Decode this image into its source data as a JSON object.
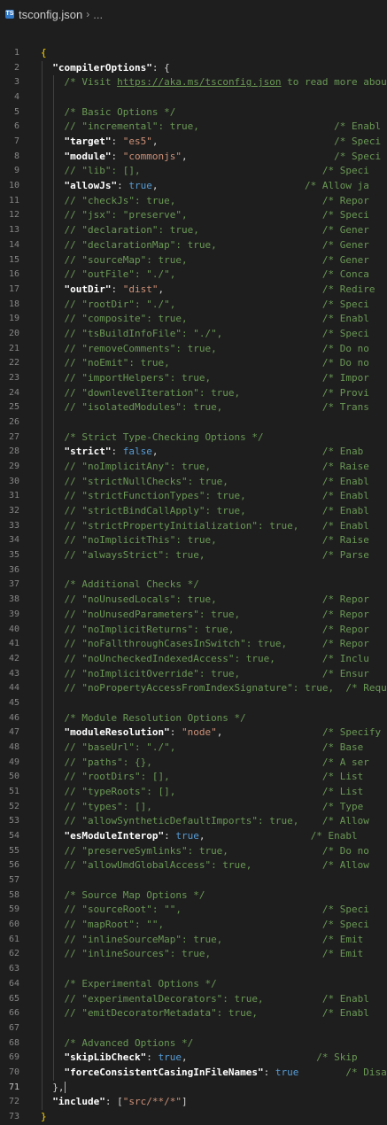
{
  "breadcrumb": {
    "icon": "typescript-file-icon",
    "file": "tsconfig.json",
    "separator": "›",
    "more": "..."
  },
  "colors": {
    "background": "#1e1e1e",
    "comment": "#6a9955",
    "string": "#ce9178",
    "keyword": "#569cd6",
    "key": "#9cdcfe"
  },
  "lines": [
    {
      "n": "1",
      "segs": [
        [
          "brk",
          "{"
        ]
      ]
    },
    {
      "n": "2",
      "segs": [
        [
          "pn",
          "  "
        ],
        [
          "keyb",
          "\"compilerOptions\""
        ],
        [
          "pn",
          ": {"
        ]
      ]
    },
    {
      "n": "3",
      "segs": [
        [
          "pn",
          "    "
        ],
        [
          "cm",
          "/* Visit "
        ],
        [
          "cm-link",
          "https://aka.ms/tsconfig.json"
        ],
        [
          "cm",
          " to read more about"
        ]
      ]
    },
    {
      "n": "4",
      "segs": []
    },
    {
      "n": "5",
      "segs": [
        [
          "pn",
          "    "
        ],
        [
          "cm",
          "/* Basic Options */"
        ]
      ]
    },
    {
      "n": "6",
      "segs": [
        [
          "pn",
          "    "
        ],
        [
          "cm",
          "// \"incremental\": true,                       /* Enabl"
        ]
      ]
    },
    {
      "n": "7",
      "segs": [
        [
          "pn",
          "    "
        ],
        [
          "keyb",
          "\"target\""
        ],
        [
          "pn",
          ": "
        ],
        [
          "str",
          "\"es5\""
        ],
        [
          "pn",
          ",                              "
        ],
        [
          "cm",
          "/* Speci"
        ]
      ]
    },
    {
      "n": "8",
      "segs": [
        [
          "pn",
          "    "
        ],
        [
          "keyb",
          "\"module\""
        ],
        [
          "pn",
          ": "
        ],
        [
          "str",
          "\"commonjs\""
        ],
        [
          "pn",
          ",                         "
        ],
        [
          "cm",
          "/* Speci"
        ]
      ]
    },
    {
      "n": "9",
      "segs": [
        [
          "pn",
          "    "
        ],
        [
          "cm",
          "// \"lib\": [],                               /* Speci"
        ]
      ]
    },
    {
      "n": "10",
      "segs": [
        [
          "pn",
          "    "
        ],
        [
          "keyb",
          "\"allowJs\""
        ],
        [
          "pn",
          ": "
        ],
        [
          "kw",
          "true"
        ],
        [
          "pn",
          ",                         "
        ],
        [
          "cm",
          "/* Allow ja"
        ]
      ]
    },
    {
      "n": "11",
      "segs": [
        [
          "pn",
          "    "
        ],
        [
          "cm",
          "// \"checkJs\": true,                         /* Repor"
        ]
      ]
    },
    {
      "n": "12",
      "segs": [
        [
          "pn",
          "    "
        ],
        [
          "cm",
          "// \"jsx\": \"preserve\",                       /* Speci"
        ]
      ]
    },
    {
      "n": "13",
      "segs": [
        [
          "pn",
          "    "
        ],
        [
          "cm",
          "// \"declaration\": true,                     /* Gener"
        ]
      ]
    },
    {
      "n": "14",
      "segs": [
        [
          "pn",
          "    "
        ],
        [
          "cm",
          "// \"declarationMap\": true,                  /* Gener"
        ]
      ]
    },
    {
      "n": "15",
      "segs": [
        [
          "pn",
          "    "
        ],
        [
          "cm",
          "// \"sourceMap\": true,                       /* Gener"
        ]
      ]
    },
    {
      "n": "16",
      "segs": [
        [
          "pn",
          "    "
        ],
        [
          "cm",
          "// \"outFile\": \"./\",                         /* Conca"
        ]
      ]
    },
    {
      "n": "17",
      "segs": [
        [
          "pn",
          "    "
        ],
        [
          "keyb",
          "\"outDir\""
        ],
        [
          "pn",
          ": "
        ],
        [
          "str",
          "\"dist\""
        ],
        [
          "pn",
          ",                           "
        ],
        [
          "cm",
          "/* Redire"
        ]
      ]
    },
    {
      "n": "18",
      "segs": [
        [
          "pn",
          "    "
        ],
        [
          "cm",
          "// \"rootDir\": \"./\",                         /* Speci"
        ]
      ]
    },
    {
      "n": "19",
      "segs": [
        [
          "pn",
          "    "
        ],
        [
          "cm",
          "// \"composite\": true,                       /* Enabl"
        ]
      ]
    },
    {
      "n": "20",
      "segs": [
        [
          "pn",
          "    "
        ],
        [
          "cm",
          "// \"tsBuildInfoFile\": \"./\",                 /* Speci"
        ]
      ]
    },
    {
      "n": "21",
      "segs": [
        [
          "pn",
          "    "
        ],
        [
          "cm",
          "// \"removeComments\": true,                  /* Do no"
        ]
      ]
    },
    {
      "n": "22",
      "segs": [
        [
          "pn",
          "    "
        ],
        [
          "cm",
          "// \"noEmit\": true,                          /* Do no"
        ]
      ]
    },
    {
      "n": "23",
      "segs": [
        [
          "pn",
          "    "
        ],
        [
          "cm",
          "// \"importHelpers\": true,                   /* Impor"
        ]
      ]
    },
    {
      "n": "24",
      "segs": [
        [
          "pn",
          "    "
        ],
        [
          "cm",
          "// \"downlevelIteration\": true,              /* Provi"
        ]
      ]
    },
    {
      "n": "25",
      "segs": [
        [
          "pn",
          "    "
        ],
        [
          "cm",
          "// \"isolatedModules\": true,                 /* Trans"
        ]
      ]
    },
    {
      "n": "26",
      "segs": []
    },
    {
      "n": "27",
      "segs": [
        [
          "pn",
          "    "
        ],
        [
          "cm",
          "/* Strict Type-Checking Options */"
        ]
      ]
    },
    {
      "n": "28",
      "segs": [
        [
          "pn",
          "    "
        ],
        [
          "keyb",
          "\"strict\""
        ],
        [
          "pn",
          ": "
        ],
        [
          "kw",
          "false"
        ],
        [
          "pn",
          ",                            "
        ],
        [
          "cm",
          "/* Enab"
        ]
      ]
    },
    {
      "n": "29",
      "segs": [
        [
          "pn",
          "    "
        ],
        [
          "cm",
          "// \"noImplicitAny\": true,                   /* Raise"
        ]
      ]
    },
    {
      "n": "30",
      "segs": [
        [
          "pn",
          "    "
        ],
        [
          "cm",
          "// \"strictNullChecks\": true,                /* Enabl"
        ]
      ]
    },
    {
      "n": "31",
      "segs": [
        [
          "pn",
          "    "
        ],
        [
          "cm",
          "// \"strictFunctionTypes\": true,             /* Enabl"
        ]
      ]
    },
    {
      "n": "32",
      "segs": [
        [
          "pn",
          "    "
        ],
        [
          "cm",
          "// \"strictBindCallApply\": true,             /* Enabl"
        ]
      ]
    },
    {
      "n": "33",
      "segs": [
        [
          "pn",
          "    "
        ],
        [
          "cm",
          "// \"strictPropertyInitialization\": true,    /* Enabl"
        ]
      ]
    },
    {
      "n": "34",
      "segs": [
        [
          "pn",
          "    "
        ],
        [
          "cm",
          "// \"noImplicitThis\": true,                  /* Raise"
        ]
      ]
    },
    {
      "n": "35",
      "segs": [
        [
          "pn",
          "    "
        ],
        [
          "cm",
          "// \"alwaysStrict\": true,                    /* Parse"
        ]
      ]
    },
    {
      "n": "36",
      "segs": []
    },
    {
      "n": "37",
      "segs": [
        [
          "pn",
          "    "
        ],
        [
          "cm",
          "/* Additional Checks */"
        ]
      ]
    },
    {
      "n": "38",
      "segs": [
        [
          "pn",
          "    "
        ],
        [
          "cm",
          "// \"noUnusedLocals\": true,                  /* Repor"
        ]
      ]
    },
    {
      "n": "39",
      "segs": [
        [
          "pn",
          "    "
        ],
        [
          "cm",
          "// \"noUnusedParameters\": true,              /* Repor"
        ]
      ]
    },
    {
      "n": "40",
      "segs": [
        [
          "pn",
          "    "
        ],
        [
          "cm",
          "// \"noImplicitReturns\": true,               /* Repor"
        ]
      ]
    },
    {
      "n": "41",
      "segs": [
        [
          "pn",
          "    "
        ],
        [
          "cm",
          "// \"noFallthroughCasesInSwitch\": true,      /* Repor"
        ]
      ]
    },
    {
      "n": "42",
      "segs": [
        [
          "pn",
          "    "
        ],
        [
          "cm",
          "// \"noUncheckedIndexedAccess\": true,        /* Inclu"
        ]
      ]
    },
    {
      "n": "43",
      "segs": [
        [
          "pn",
          "    "
        ],
        [
          "cm",
          "// \"noImplicitOverride\": true,              /* Ensur"
        ]
      ]
    },
    {
      "n": "44",
      "segs": [
        [
          "pn",
          "    "
        ],
        [
          "cm",
          "// \"noPropertyAccessFromIndexSignature\": true,  /* Requi"
        ]
      ]
    },
    {
      "n": "45",
      "segs": []
    },
    {
      "n": "46",
      "segs": [
        [
          "pn",
          "    "
        ],
        [
          "cm",
          "/* Module Resolution Options */"
        ]
      ]
    },
    {
      "n": "47",
      "segs": [
        [
          "pn",
          "    "
        ],
        [
          "keyb",
          "\"moduleResolution\""
        ],
        [
          "pn",
          ": "
        ],
        [
          "str",
          "\"node\""
        ],
        [
          "pn",
          ",                 "
        ],
        [
          "cm",
          "/* Specify"
        ]
      ]
    },
    {
      "n": "48",
      "segs": [
        [
          "pn",
          "    "
        ],
        [
          "cm",
          "// \"baseUrl\": \"./\",                         /* Base"
        ]
      ]
    },
    {
      "n": "49",
      "segs": [
        [
          "pn",
          "    "
        ],
        [
          "cm",
          "// \"paths\": {},                             /* A ser"
        ]
      ]
    },
    {
      "n": "50",
      "segs": [
        [
          "pn",
          "    "
        ],
        [
          "cm",
          "// \"rootDirs\": [],                          /* List"
        ]
      ]
    },
    {
      "n": "51",
      "segs": [
        [
          "pn",
          "    "
        ],
        [
          "cm",
          "// \"typeRoots\": [],                         /* List"
        ]
      ]
    },
    {
      "n": "52",
      "segs": [
        [
          "pn",
          "    "
        ],
        [
          "cm",
          "// \"types\": [],                             /* Type"
        ]
      ]
    },
    {
      "n": "53",
      "segs": [
        [
          "pn",
          "    "
        ],
        [
          "cm",
          "// \"allowSyntheticDefaultImports\": true,    /* Allow"
        ]
      ]
    },
    {
      "n": "54",
      "segs": [
        [
          "pn",
          "    "
        ],
        [
          "keyb",
          "\"esModuleInterop\""
        ],
        [
          "pn",
          ": "
        ],
        [
          "kw",
          "true"
        ],
        [
          "pn",
          ",                  "
        ],
        [
          "cm",
          "/* Enabl"
        ]
      ]
    },
    {
      "n": "55",
      "segs": [
        [
          "pn",
          "    "
        ],
        [
          "cm",
          "// \"preserveSymlinks\": true,                /* Do no"
        ]
      ]
    },
    {
      "n": "56",
      "segs": [
        [
          "pn",
          "    "
        ],
        [
          "cm",
          "// \"allowUmdGlobalAccess\": true,            /* Allow"
        ]
      ]
    },
    {
      "n": "57",
      "segs": []
    },
    {
      "n": "58",
      "segs": [
        [
          "pn",
          "    "
        ],
        [
          "cm",
          "/* Source Map Options */"
        ]
      ]
    },
    {
      "n": "59",
      "segs": [
        [
          "pn",
          "    "
        ],
        [
          "cm",
          "// \"sourceRoot\": \"\",                        /* Speci"
        ]
      ]
    },
    {
      "n": "60",
      "segs": [
        [
          "pn",
          "    "
        ],
        [
          "cm",
          "// \"mapRoot\": \"\",                           /* Speci"
        ]
      ]
    },
    {
      "n": "61",
      "segs": [
        [
          "pn",
          "    "
        ],
        [
          "cm",
          "// \"inlineSourceMap\": true,                 /* Emit"
        ]
      ]
    },
    {
      "n": "62",
      "segs": [
        [
          "pn",
          "    "
        ],
        [
          "cm",
          "// \"inlineSources\": true,                   /* Emit"
        ]
      ]
    },
    {
      "n": "63",
      "segs": []
    },
    {
      "n": "64",
      "segs": [
        [
          "pn",
          "    "
        ],
        [
          "cm",
          "/* Experimental Options */"
        ]
      ]
    },
    {
      "n": "65",
      "segs": [
        [
          "pn",
          "    "
        ],
        [
          "cm",
          "// \"experimentalDecorators\": true,          /* Enabl"
        ]
      ]
    },
    {
      "n": "66",
      "segs": [
        [
          "pn",
          "    "
        ],
        [
          "cm",
          "// \"emitDecoratorMetadata\": true,           /* Enabl"
        ]
      ]
    },
    {
      "n": "67",
      "segs": []
    },
    {
      "n": "68",
      "segs": [
        [
          "pn",
          "    "
        ],
        [
          "cm",
          "/* Advanced Options */"
        ]
      ]
    },
    {
      "n": "69",
      "segs": [
        [
          "pn",
          "    "
        ],
        [
          "keyb",
          "\"skipLibCheck\""
        ],
        [
          "pn",
          ": "
        ],
        [
          "kw",
          "true"
        ],
        [
          "pn",
          ",                      "
        ],
        [
          "cm",
          "/* Skip"
        ]
      ]
    },
    {
      "n": "70",
      "segs": [
        [
          "pn",
          "    "
        ],
        [
          "keyb",
          "\"forceConsistentCasingInFileNames\""
        ],
        [
          "pn",
          ": "
        ],
        [
          "kw",
          "true"
        ],
        [
          "pn",
          "        "
        ],
        [
          "cm",
          "/* Disal"
        ]
      ]
    },
    {
      "n": "71",
      "segs": [
        [
          "pn",
          "  },"
        ]
      ],
      "cursor": true
    },
    {
      "n": "72",
      "segs": [
        [
          "pn",
          "  "
        ],
        [
          "keyb",
          "\"include\""
        ],
        [
          "pn",
          ": ["
        ],
        [
          "str",
          "\"src/**/*\""
        ],
        [
          "pn",
          "]"
        ]
      ]
    },
    {
      "n": "73",
      "segs": [
        [
          "brk",
          "}"
        ]
      ]
    }
  ]
}
